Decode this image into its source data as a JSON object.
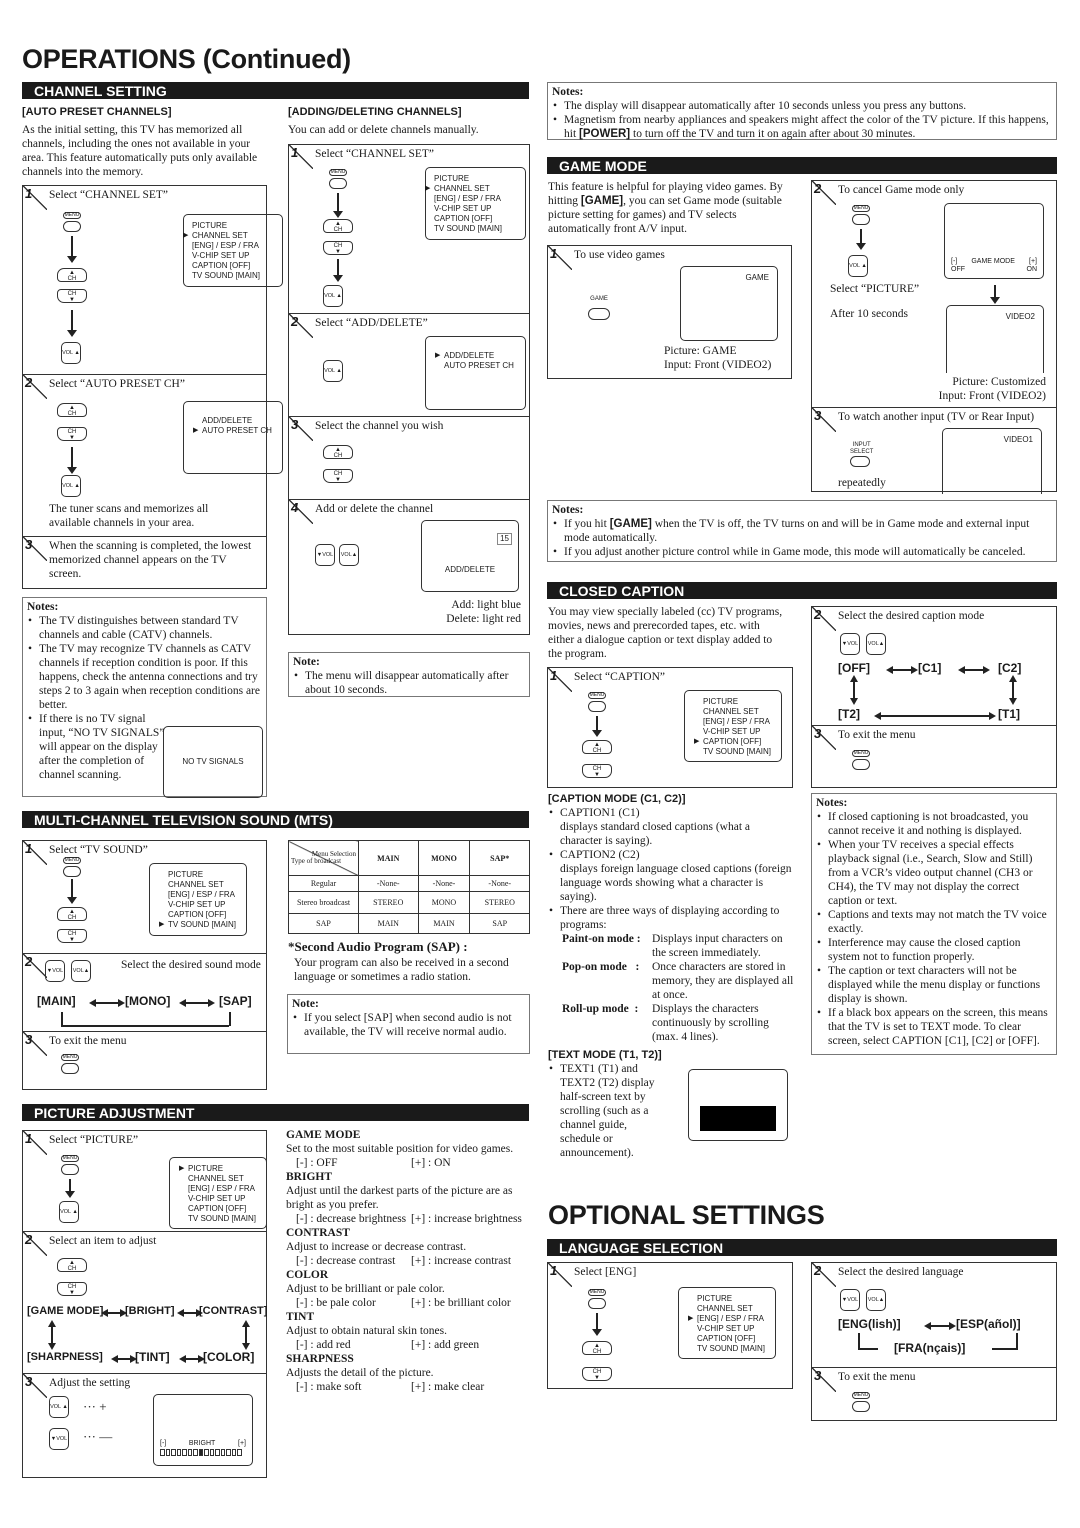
{
  "page_title": "OPERATIONS (Continued)",
  "channel_setting": {
    "header": "CHANNEL SETTING",
    "auto": {
      "title": "[AUTO PRESET CHANNELS]",
      "intro": "As the initial setting, this TV has memorized all channels, including the ones not available in your area. This feature automatically puts only available channels into the memory.",
      "steps": [
        {
          "num": "1",
          "text": "Select “CHANNEL SET”"
        },
        {
          "num": "2",
          "text": "Select “AUTO PRESET CH”",
          "detail": "The tuner scans and memorizes all available channels in your area."
        },
        {
          "num": "3",
          "text": "When the scanning is completed, the lowest memorized channel appears on the TV screen."
        }
      ],
      "menu1": [
        "PICTURE",
        "CHANNEL SET",
        "[ENG] / ESP / FRA",
        "V-CHIP SET UP",
        "CAPTION [OFF]",
        "TV SOUND [MAIN]"
      ],
      "menu2": [
        "ADD/DELETE",
        "AUTO PRESET CH"
      ],
      "notes_title": "Notes:",
      "notes": [
        "The TV distinguishes between standard TV channels and cable (CATV) channels.",
        "The TV may recognize TV channels as CATV channels if reception condition is poor. If this happens, check the antenna connections and try steps 2 to 3 again when reception conditions are better.",
        "If there is no TV signal input, “NO TV SIGNALS” will appear on the display after the completion of channel scanning."
      ],
      "no_signal": "NO TV SIGNALS"
    },
    "adddel": {
      "title": "[ADDING/DELETING CHANNELS]",
      "intro": "You can add or delete channels manually.",
      "steps": [
        {
          "num": "1",
          "text": "Select “CHANNEL SET”"
        },
        {
          "num": "2",
          "text": "Select “ADD/DELETE”"
        },
        {
          "num": "3",
          "text": "Select the channel you wish"
        },
        {
          "num": "4",
          "text": "Add or delete the channel"
        }
      ],
      "menu2": [
        "ADD/DELETE",
        "AUTO PRESET CH"
      ],
      "channel_num": "15",
      "osd_label": "ADD/DELETE",
      "add_color": "Add: light blue",
      "delete_color": "Delete: light red",
      "note_title": "Note:",
      "note": "The menu will disappear automatically after about 10 seconds."
    }
  },
  "buttons": {
    "menu": "MENU",
    "ch": "CH",
    "vol": "VOL",
    "game": "GAME",
    "input": "INPUT",
    "select": "SELECT"
  },
  "mts": {
    "header": "MULTI-CHANNEL TELEVISION SOUND (MTS)",
    "steps": [
      {
        "num": "1",
        "text": "Select “TV SOUND”"
      },
      {
        "num": "2",
        "text": "Select the desired sound mode"
      },
      {
        "num": "3",
        "text": "To exit the menu"
      }
    ],
    "menu": [
      "PICTURE",
      "CHANNEL SET",
      "[ENG] / ESP / FRA",
      "V-CHIP SET UP",
      "CAPTION  [OFF]",
      "TV SOUND [MAIN]"
    ],
    "flow": [
      "[MAIN]",
      "[MONO]",
      "[SAP]"
    ],
    "table": {
      "corner_top": "Menu Selection",
      "corner_bottom": "Type of broadcast",
      "cols": [
        "MAIN",
        "MONO",
        "SAP*"
      ],
      "rows": [
        {
          "type": "Regular",
          "vals": [
            "-None-",
            "-None-",
            "-None-"
          ]
        },
        {
          "type": "Stereo broadcast",
          "vals": [
            "STEREO",
            "MONO",
            "STEREO"
          ]
        },
        {
          "type": "SAP",
          "vals": [
            "MAIN",
            "MAIN",
            "SAP"
          ]
        }
      ]
    },
    "sap_title": "*Second Audio Program (SAP) :",
    "sap_text": "Your program can also be received in a second language or sometimes a radio station.",
    "note_title": "Note:",
    "note": "If you select [SAP] when second audio is not available, the TV will receive normal audio."
  },
  "picture": {
    "header": "PICTURE ADJUSTMENT",
    "steps": [
      {
        "num": "1",
        "text": "Select “PICTURE”"
      },
      {
        "num": "2",
        "text": "Select an item to adjust"
      },
      {
        "num": "3",
        "text": "Adjust the setting"
      }
    ],
    "menu": [
      "PICTURE",
      "CHANNEL SET",
      "[ENG] / ESP / FRA",
      "V-CHIP SET UP",
      "CAPTION  [OFF]",
      "TV SOUND [MAIN]"
    ],
    "flow_top": [
      "[GAME MODE]",
      "[BRIGHT]",
      "[CONTRAST]"
    ],
    "flow_bottom": [
      "[SHARPNESS]",
      "[TINT]",
      "[COLOR]"
    ],
    "plus": "··· +",
    "minus": "··· —",
    "slider": {
      "minus": "[-]",
      "label": "BRIGHT",
      "plus": "[+]",
      "segments": 15,
      "position": 8
    },
    "items": [
      {
        "title": "GAME MODE",
        "desc": "Set to the most suitable position for video games.",
        "minus": "[-] : OFF",
        "plus": "[+] : ON"
      },
      {
        "title": "BRIGHT",
        "desc": "Adjust until the darkest parts of the picture are as bright as you prefer.",
        "minus": "[-] : decrease brightness",
        "plus": "[+] : increase brightness"
      },
      {
        "title": "CONTRAST",
        "desc": "Adjust to increase or decrease contrast.",
        "minus": "[-] : decrease contrast",
        "plus": "[+] : increase contrast"
      },
      {
        "title": "COLOR",
        "desc": "Adjust to be brilliant or pale color.",
        "minus": "[-] : be pale color",
        "plus": "[+] : be brilliant color"
      },
      {
        "title": "TINT",
        "desc": "Adjust to obtain natural skin tones.",
        "minus": "[-] : add red",
        "plus": "[+] : add green"
      },
      {
        "title": "SHARPNESS",
        "desc": "Adjusts the detail of the picture.",
        "minus": "[-] : make soft",
        "plus": "[+] : make clear"
      }
    ]
  },
  "top_notes": {
    "title": "Notes:",
    "items": [
      "The display will disappear automatically after 10 seconds unless you press any buttons.",
      "Magnetism from nearby appliances and speakers might affect the color of the TV picture. If this happens, hit [POWER] to turn off the TV and turn it on again after about 30 minutes."
    ]
  },
  "game": {
    "header": "GAME MODE",
    "intro": "This feature is helpful for playing video games. By hitting [GAME], you can set Game mode (suitable picture setting for games) and TV selects automatically front A/V input.",
    "step1": {
      "num": "1",
      "text": "To use video games",
      "osd": "GAME",
      "cap1": "Picture: GAME",
      "cap2": "Input: Front (VIDEO2)"
    },
    "step2": {
      "num": "2",
      "text": "To cancel Game mode only",
      "osd_minus": "[-]",
      "osd_label": "GAME MODE",
      "osd_plus": "[+]",
      "osd_off": "OFF",
      "osd_on": "ON",
      "select": "Select “PICTURE”",
      "after": "After 10 seconds",
      "osd2": "VIDEO2",
      "cap1": "Picture: Customized",
      "cap2": "Input: Front (VIDEO2)"
    },
    "step3": {
      "num": "3",
      "text": "To watch another input (TV or Rear Input)",
      "osd": "VIDEO1",
      "repeat": "repeatedly"
    },
    "notes_title": "Notes:",
    "notes": [
      "If you hit [GAME] when the TV is off, the TV turns on and will be in Game mode and external input mode automatically.",
      "If you adjust another picture control while in Game mode, this mode will automatically be canceled."
    ]
  },
  "caption": {
    "header": "CLOSED CAPTION",
    "intro": "You may view specially labeled (cc) TV programs, movies, news and prerecorded tapes, etc. with either a dialogue caption or text display added to the program.",
    "steps": [
      {
        "num": "1",
        "text": "Select “CAPTION”"
      },
      {
        "num": "2",
        "text": "Select the desired caption mode"
      },
      {
        "num": "3",
        "text": "To exit the menu"
      }
    ],
    "menu": [
      "PICTURE",
      "CHANNEL SET",
      "[ENG] / ESP / FRA",
      "V-CHIP SET UP",
      "CAPTION [OFF]",
      "TV SOUND [MAIN]"
    ],
    "flow": [
      "[OFF]",
      "[C1]",
      "[C2]",
      "[T2]",
      "[T1]"
    ],
    "mode_title": "[CAPTION MODE (C1, C2)]",
    "c1_title": "CAPTION1 (C1)",
    "c1_desc": "displays standard closed captions (what a character is saying).",
    "c2_title": "CAPTION2 (C2)",
    "c2_desc": "displays foreign language closed captions (foreign language words showing what a character is saying).",
    "ways": "There are three ways of displaying according to programs:",
    "modes": [
      {
        "name": "Paint-on mode :",
        "desc": "Displays input characters on the screen immediately."
      },
      {
        "name": "Pop-on mode   :",
        "desc": "Once characters are stored in memory, they are displayed all at once."
      },
      {
        "name": "Roll-up mode  :",
        "desc": "Displays the characters continuously by scrolling (max. 4 lines)."
      }
    ],
    "text_title": "[TEXT MODE (T1, T2)]",
    "text_desc": "TEXT1 (T1) and TEXT2 (T2) display half-screen text by scrolling (such as a channel guide, schedule or announcement).",
    "notes_title": "Notes:",
    "notes": [
      "If closed captioning is not broadcasted, you cannot receive it and nothing is displayed.",
      "When your TV receives a special effects playback signal (i.e., Search, Slow and Still) from a VCR’s video output channel (CH3 or CH4), the TV may not display the correct caption or text.",
      "Captions and texts may not match the TV voice exactly.",
      "Interference may cause the closed caption system not to function properly.",
      "The caption or text characters will not be displayed while the menu display or functions display is shown.",
      "If a black box appears on the screen, this means that the TV is set to TEXT mode. To clear screen, select CAPTION [C1], [C2] or [OFF]."
    ]
  },
  "optional": {
    "title": "OPTIONAL SETTINGS",
    "header": "LANGUAGE SELECTION",
    "steps": [
      {
        "num": "1",
        "text": "Select [ENG]"
      },
      {
        "num": "2",
        "text": "Select the desired language"
      },
      {
        "num": "3",
        "text": "To exit the menu"
      }
    ],
    "menu": [
      "PICTURE",
      "CHANNEL SET",
      "[ENG] / ESP / FRA",
      "V-CHIP SET UP",
      "CAPTION [OFF]",
      "TV SOUND [MAIN]"
    ],
    "flow": [
      "[ENG(lish)]",
      "[ESP(añol)]",
      "[FRA(nçais)]"
    ]
  }
}
